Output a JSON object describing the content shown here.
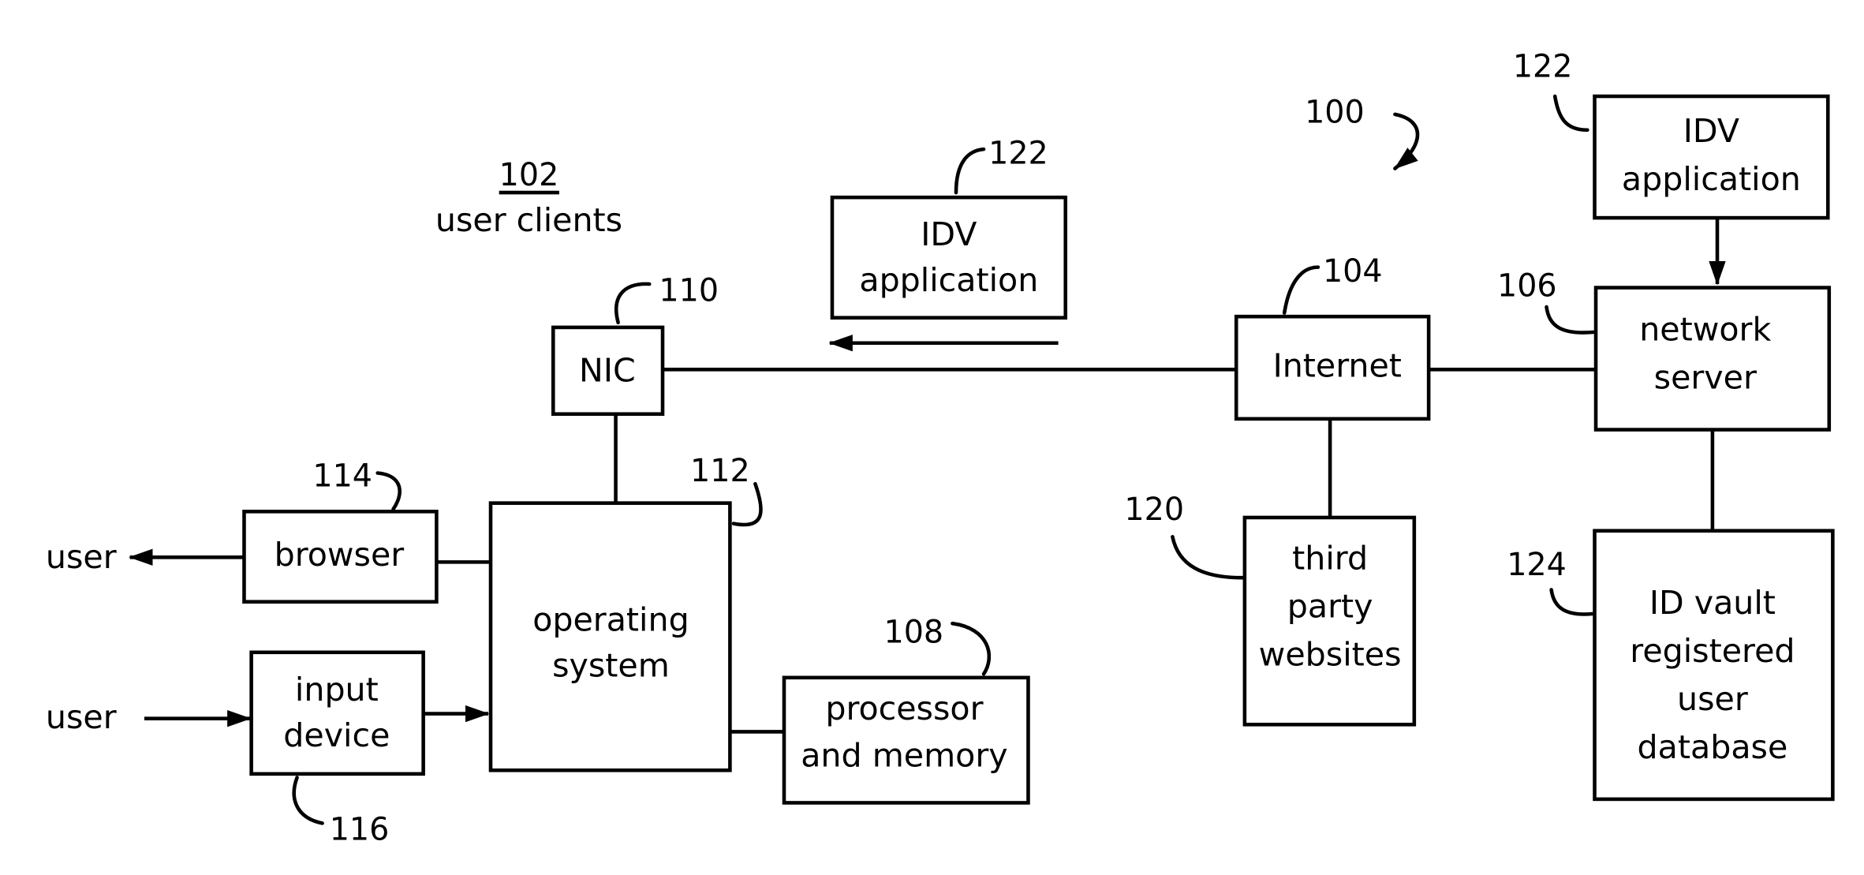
{
  "diagram": {
    "system_ref": "100",
    "group_label": {
      "ref": "102",
      "text": "user clients"
    },
    "boxes": {
      "nic": {
        "ref": "110",
        "lines": [
          "NIC"
        ]
      },
      "idv_client": {
        "ref": "122",
        "lines": [
          "IDV",
          "application"
        ]
      },
      "internet": {
        "ref": "104",
        "lines": [
          "Internet"
        ]
      },
      "idv_server": {
        "ref": "122",
        "lines": [
          "IDV",
          "application"
        ]
      },
      "network_server": {
        "ref": "106",
        "lines": [
          "network",
          "server"
        ]
      },
      "third_party": {
        "ref": "120",
        "lines": [
          "third",
          "party",
          "websites"
        ]
      },
      "id_vault": {
        "ref": "124",
        "lines": [
          "ID vault",
          "registered",
          "user",
          "database"
        ]
      },
      "browser": {
        "ref": "114",
        "lines": [
          "browser"
        ]
      },
      "os": {
        "ref": "112",
        "lines": [
          "operating",
          "system"
        ]
      },
      "input_device": {
        "ref": "116",
        "lines": [
          "input",
          "device"
        ]
      },
      "processor": {
        "ref": "108",
        "lines": [
          "processor",
          "and memory"
        ]
      }
    },
    "external": {
      "user_out": "user",
      "user_in": "user"
    }
  }
}
